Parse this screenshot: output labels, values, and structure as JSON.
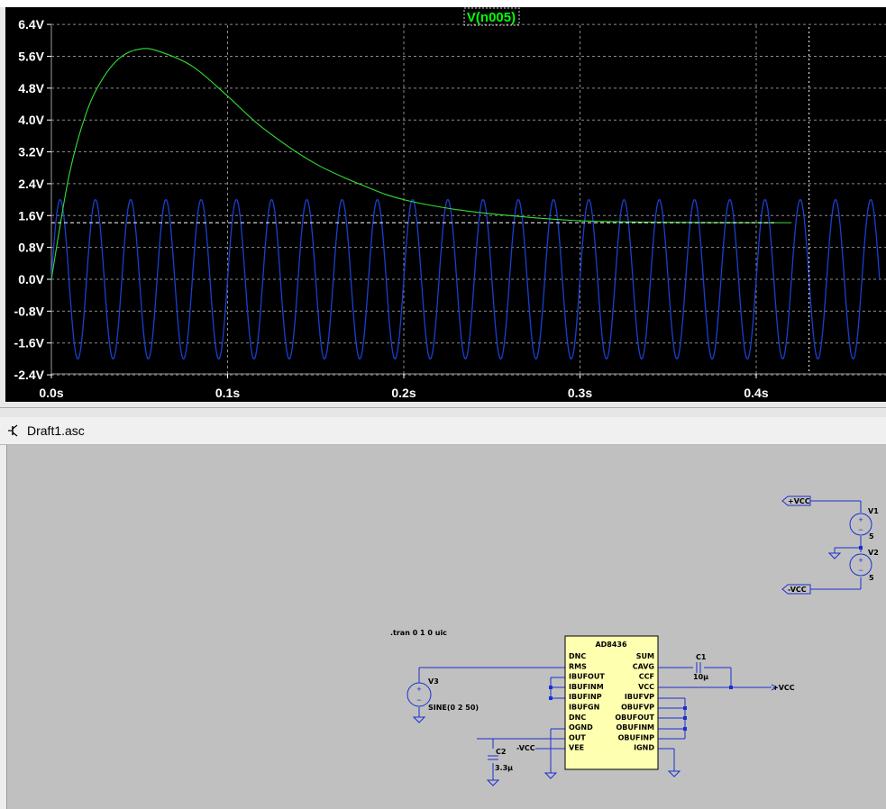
{
  "plot": {
    "trace_label": "V(n005)",
    "colors": {
      "background": "#000000",
      "trace_green": "#33dd33",
      "trace_blue": "#1a3fd0",
      "axis_text": "#ffffff",
      "grid": "#9a9a9a",
      "label_green": "#00ff00"
    },
    "chart_data": {
      "type": "line",
      "y_ticks": [
        "6.4V",
        "5.6V",
        "4.8V",
        "4.0V",
        "3.2V",
        "2.4V",
        "1.6V",
        "0.8V",
        "0.0V",
        "-0.8V",
        "-1.6V",
        "-2.4V"
      ],
      "x_ticks": [
        "0.0s",
        "0.1s",
        "0.2s",
        "0.3s",
        "0.4s"
      ],
      "ylim": [
        -2.4,
        6.4
      ],
      "xlim": [
        0.0,
        0.47
      ],
      "series": [
        {
          "name": "V(n005)",
          "color": "#33dd33",
          "kind": "rms-output",
          "points": [
            [
              0.0,
              0.0
            ],
            [
              0.01,
              2.6
            ],
            [
              0.02,
              4.2
            ],
            [
              0.03,
              5.1
            ],
            [
              0.04,
              5.6
            ],
            [
              0.05,
              5.78
            ],
            [
              0.06,
              5.74
            ],
            [
              0.08,
              5.35
            ],
            [
              0.1,
              4.6
            ],
            [
              0.12,
              3.8
            ],
            [
              0.15,
              2.9
            ],
            [
              0.18,
              2.3
            ],
            [
              0.2,
              2.0
            ],
            [
              0.23,
              1.75
            ],
            [
              0.26,
              1.6
            ],
            [
              0.3,
              1.47
            ],
            [
              0.35,
              1.43
            ],
            [
              0.4,
              1.42
            ],
            [
              0.42,
              1.42
            ]
          ]
        },
        {
          "kind": "sine",
          "color": "#1a3fd0",
          "amplitude": 2,
          "offset": 0,
          "frequency_hz": 50
        }
      ],
      "cursor_level": 1.42,
      "cursor_x": 0.43,
      "grid": true
    }
  },
  "schematic": {
    "tab_title": "Draft1.asc",
    "directive": ".tran 0 1 0 uic",
    "ic": {
      "name": "AD8436",
      "left_pins": [
        "DNC",
        "RMS",
        "IBUFOUT",
        "IBUFINM",
        "IBUFINP",
        "IBUFGN",
        "DNC",
        "OGND",
        "OUT",
        "VEE"
      ],
      "right_pins": [
        "SUM",
        "CAVG",
        "CCF",
        "VCC",
        "IBUFVP",
        "OBUFVP",
        "OBUFOUT",
        "OBUFINM",
        "OBUFINP",
        "IGND"
      ]
    },
    "c1": {
      "name": "C1",
      "value": "10µ"
    },
    "c2": {
      "name": "C2",
      "value": "3.3µ"
    },
    "v3": {
      "name": "V3",
      "value": "SINE(0 2 50)"
    },
    "v1": {
      "name": "V1",
      "value": "5"
    },
    "v2": {
      "name": "V2",
      "value": "5"
    },
    "labels": {
      "plus_vcc": "+VCC",
      "minus_vcc": "-VCC",
      "vcc_net": "+VCC",
      "vee_net": "-VCC"
    }
  }
}
